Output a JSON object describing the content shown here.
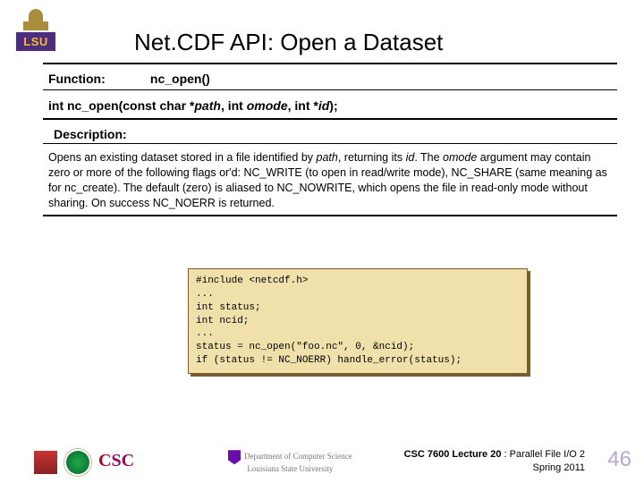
{
  "logo_text": "LSU",
  "title": "Net.CDF API: Open a Dataset",
  "function_row": {
    "label": "Function:",
    "value": "nc_open()"
  },
  "signature": {
    "ret": "int",
    "name": "nc_open(const char *",
    "p1": "path",
    "mid1": ", int ",
    "p2": "omode",
    "mid2": ", int *",
    "p3": "id",
    "end": ");"
  },
  "description_label": "Description:",
  "description_parts": {
    "t1": "Opens an existing dataset stored in a file identified by ",
    "i1": "path",
    "t2": ", returning its ",
    "i2": "id",
    "t3": ". The ",
    "i3": "omode",
    "t4": " argument may contain zero or more of the following flags or'd: NC_WRITE (to open in read/write mode), NC_SHARE (same meaning as for nc_create). The default (zero) is aliased to NC_NOWRITE, which opens the file in read-only mode without sharing. On success NC_NOERR is returned."
  },
  "code": "#include <netcdf.h>\n...\nint status;\nint ncid;\n...\nstatus = nc_open(\"foo.nc\", 0, &ncid);\nif (status != NC_NOERR) handle_error(status);",
  "footer": {
    "csc": "CSC",
    "dept1": "Department of Computer Science",
    "dept2": "Louisiana State University",
    "course": "CSC 7600",
    "lecture": " Lecture 20 ",
    "topic": ": Parallel File I/O 2",
    "term": "Spring 2011",
    "page": "46"
  }
}
